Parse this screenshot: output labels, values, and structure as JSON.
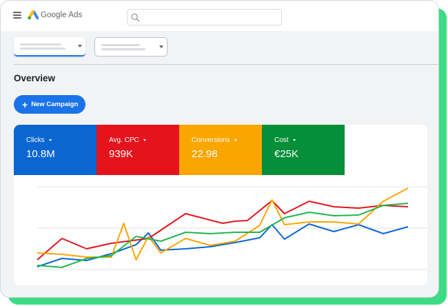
{
  "app": {
    "brand": "Google Ads"
  },
  "search": {
    "value": "",
    "placeholder": ""
  },
  "overview": {
    "title": "Overview",
    "new_campaign_label": "New Campaign"
  },
  "metrics": [
    {
      "label": "Clicks",
      "value": "10.8M",
      "color": "#0b66d2"
    },
    {
      "label": "Avg. CPC",
      "value": "939K",
      "color": "#e5131b"
    },
    {
      "label": "Conversions",
      "value": "22.98",
      "color": "#fba500"
    },
    {
      "label": "Cost",
      "value": "€25K",
      "color": "#068e38"
    }
  ],
  "colors": {
    "accent": "#1a73e8",
    "frame": "#3ddc84"
  },
  "chart_data": {
    "type": "line",
    "grid": true,
    "legend": "none",
    "x": [
      0,
      1,
      2,
      3,
      4,
      5,
      6,
      7,
      8,
      9,
      10,
      11,
      12,
      13,
      14,
      15,
      16,
      17,
      18,
      19,
      20,
      21,
      22,
      23
    ],
    "ylim": [
      0,
      100
    ],
    "series": [
      {
        "color": "#0b66d2",
        "x": [
          0,
          2,
          4,
          6,
          8,
          9,
          10,
          12,
          14,
          16,
          18,
          19,
          20,
          22,
          24,
          26,
          28,
          30
        ],
        "y": [
          4,
          16,
          13,
          23,
          36,
          53,
          28,
          30,
          33,
          39,
          46,
          65,
          44,
          66,
          55,
          65,
          52,
          62
        ]
      },
      {
        "color": "#e5131b",
        "x": [
          0,
          2,
          4,
          6,
          9,
          12,
          15,
          16,
          17,
          19,
          20,
          22,
          24,
          26,
          28,
          30
        ],
        "y": [
          14,
          45,
          30,
          38,
          45,
          81,
          67,
          70,
          71,
          100,
          81,
          99,
          91,
          89,
          93,
          91
        ]
      },
      {
        "color": "#fba500",
        "x": [
          0,
          2,
          4,
          6,
          7,
          8,
          9,
          10,
          12,
          14,
          16,
          18,
          19,
          20,
          22,
          24,
          26,
          28,
          30
        ],
        "y": [
          24,
          22,
          18,
          18,
          67,
          14,
          48,
          24,
          45,
          35,
          41,
          64,
          101,
          65,
          69,
          69,
          66,
          99,
          118
        ]
      },
      {
        "color": "#1cb64d",
        "x": [
          0,
          2,
          4,
          6,
          8,
          10,
          12,
          14,
          16,
          18,
          20,
          22,
          24,
          26,
          28,
          30
        ],
        "y": [
          6,
          3,
          16,
          20,
          48,
          41,
          54,
          52,
          54,
          54,
          75,
          83,
          78,
          79,
          93,
          96
        ]
      }
    ]
  }
}
